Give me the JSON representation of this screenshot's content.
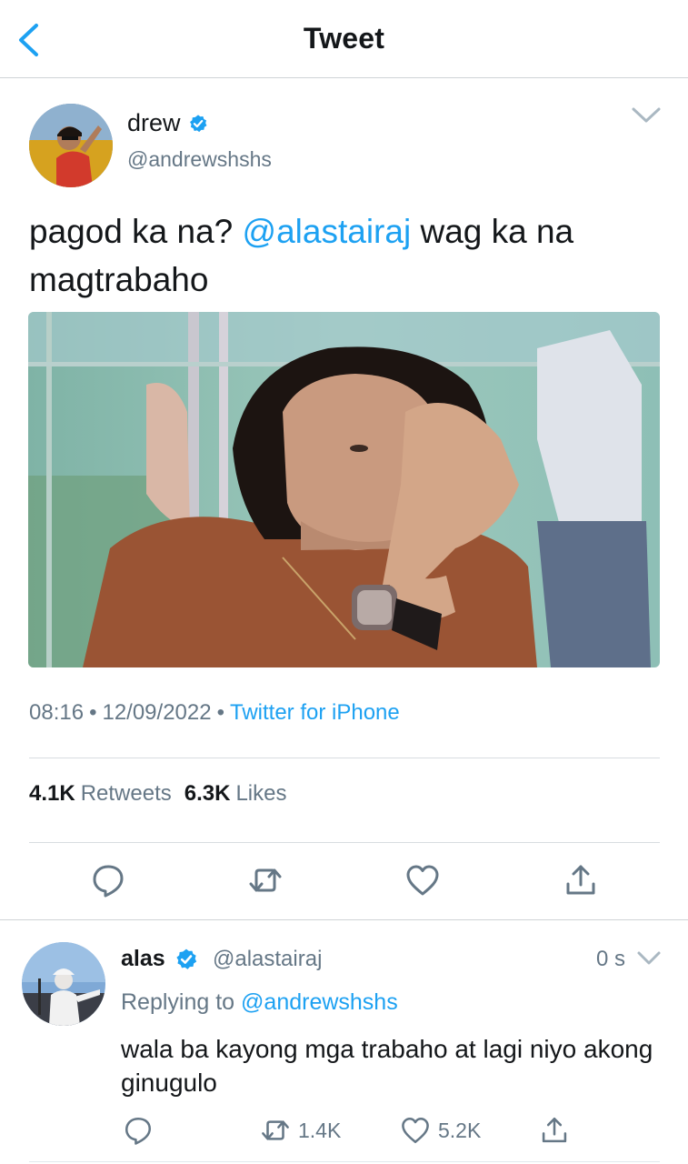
{
  "header": {
    "title": "Tweet"
  },
  "tweet": {
    "author_name": "drew",
    "author_handle": "@andrewshshs",
    "text_before": "pagod ka na? ",
    "mention": "@alastairaj",
    "text_after": " wag ka na magtrabaho",
    "time": "08:16",
    "date": "12/09/2022",
    "source": "Twitter for iPhone",
    "retweets_count": "4.1K",
    "retweets_label": "Retweets",
    "likes_count": "6.3K",
    "likes_label": "Likes"
  },
  "reply": {
    "author_name": "alas",
    "author_handle": "@alastairaj",
    "time": "0 s",
    "replying_label": "Replying to",
    "replying_to": "@andrewshshs",
    "text": "wala ba kayong mga trabaho at lagi niyo akong ginugulo",
    "retweet_count": "1.4K",
    "like_count": "5.2K"
  },
  "colors": {
    "accent": "#1da1f2",
    "text": "#14171a",
    "secondary": "#657786"
  },
  "icons": [
    "chevron-left-icon",
    "verified-badge-icon",
    "chevron-down-icon",
    "reply-icon",
    "retweet-icon",
    "like-icon",
    "share-icon"
  ]
}
